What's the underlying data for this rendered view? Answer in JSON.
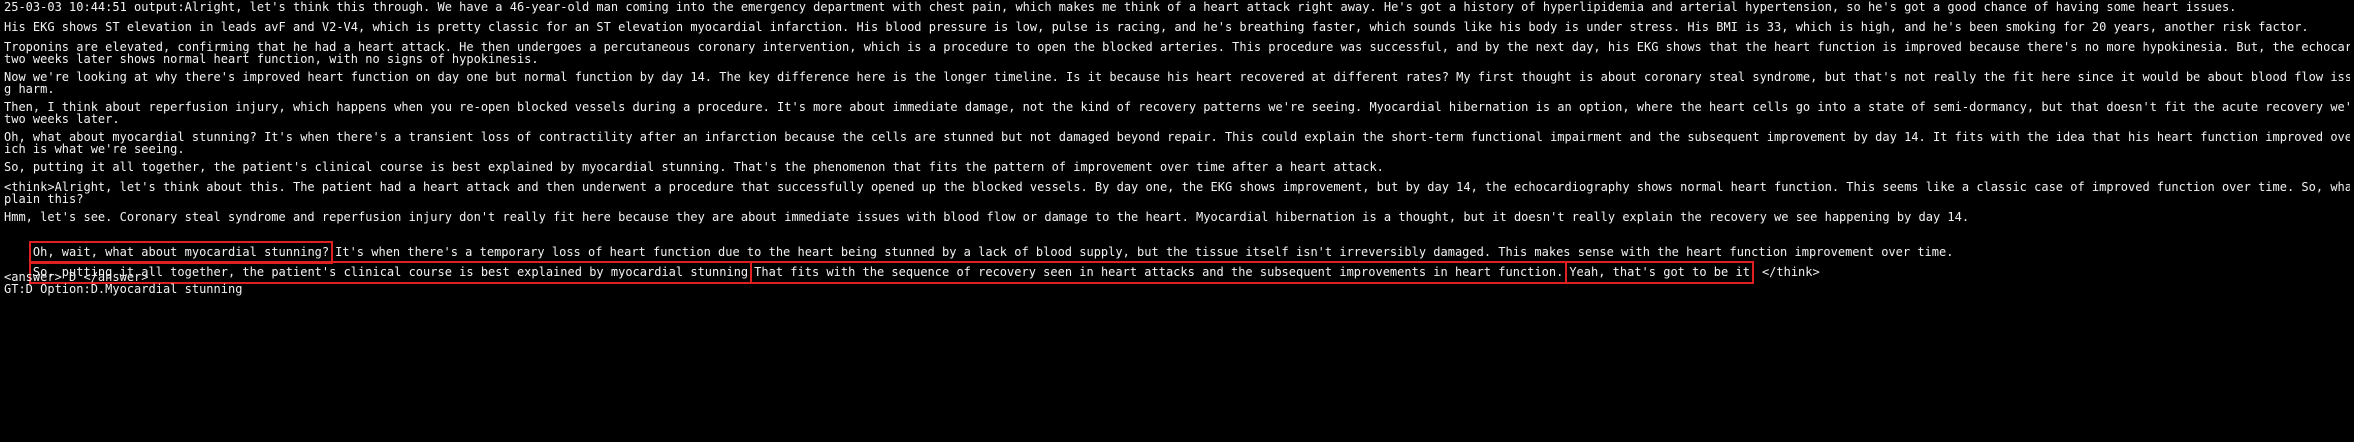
{
  "lines": [
    "25-03-03 10:44:51 output:Alright, let's think this through. We have a 46-year-old man coming into the emergency department with chest pain, which makes me think of a heart attack right away. He's got a history of hyperlipidemia and arterial hypertension, so he's got a good chance of having some heart issues.",
    "His EKG shows ST elevation in leads avF and V2-V4, which is pretty classic for an ST elevation myocardial infarction. His blood pressure is low, pulse is racing, and he's breathing faster, which sounds like his body is under stress. His BMI is 33, which is high, and he's been smoking for 20 years, another risk factor.",
    "Troponins are elevated, confirming that he had a heart attack. He then undergoes a percutaneous coronary intervention, which is a procedure to open the blocked arteries. This procedure was successful, and by the next day, his EKG shows that the heart function is improved because there's no more hypokinesia. But, the echocardiography",
    "two weeks later shows normal heart function, with no signs of hypokinesis.",
    "Now we're looking at why there's improved heart function on day one but normal function by day 14. The key difference here is the longer timeline. Is it because his heart recovered at different rates? My first thought is about coronary steal syndrome, but that's not really the fit here since it would be about blood flow issues causin",
    "g harm.",
    "Then, I think about reperfusion injury, which happens when you re-open blocked vessels during a procedure. It's more about immediate damage, not the kind of recovery patterns we're seeing. Myocardial hibernation is an option, where the heart cells go into a state of semi-dormancy, but that doesn't fit the acute recovery we're seeing",
    "two weeks later.",
    "Oh, what about myocardial stunning? It's when there's a transient loss of contractility after an infarction because the cells are stunned but not damaged beyond repair. This could explain the short-term functional impairment and the subsequent improvement by day 14. It fits with the idea that his heart function improved over time, wh",
    "ich is what we're seeing.",
    "So, putting it all together, the patient's clinical course is best explained by myocardial stunning. That's the phenomenon that fits the pattern of improvement over time after a heart attack.",
    "<think>Alright, let's think about this. The patient had a heart attack and then underwent a procedure that successfully opened up the blocked vessels. By day one, the EKG shows improvement, but by day 14, the echocardiography shows normal heart function. This seems like a classic case of improved function over time. So, what could ex",
    "plain this?",
    "Hmm, let's see. Coronary steal syndrome and reperfusion injury don't really fit here because they are about immediate issues with blood flow or damage to the heart. Myocardial hibernation is a thought, but it doesn't really explain the recovery we see happening by day 14."
  ],
  "highlight_line_1": {
    "boxed": "Oh, wait, what about myocardial stunning?",
    "rest": "It's when there's a temporary loss of heart function due to the heart being stunned by a lack of blood supply, but the tissue itself isn't irreversibly damaged. This makes sense with the heart function improvement over time."
  },
  "highlight_line_2": {
    "boxed_1": "So, putting it all together, the patient's clinical course is best explained by myocardial stunning",
    "boxed_2": "That fits with the sequence of recovery seen in heart attacks and the subsequent improvements in heart function.",
    "boxed_3": "Yeah, that's got to be it",
    "rest": "</think>"
  },
  "answer_line": "<answer> D </answer>",
  "gt_line": "GT:D Option:D.Myocardial stunning",
  "highlight_color": "#e02020"
}
